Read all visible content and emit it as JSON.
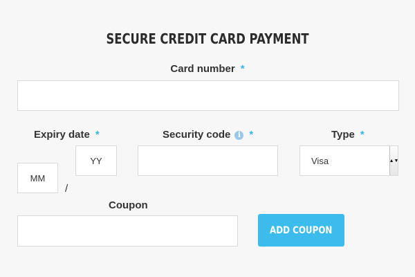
{
  "form": {
    "title": "SECURE CREDIT CARD PAYMENT",
    "required_mark": "*",
    "card_number": {
      "label": "Card number",
      "value": ""
    },
    "expiry": {
      "label": "Expiry date",
      "month_placeholder": "MM",
      "year_placeholder": "YY",
      "separator": "/"
    },
    "security_code": {
      "label": "Security code",
      "info_icon": "info-icon",
      "value": ""
    },
    "type": {
      "label": "Type",
      "selected": "Visa"
    },
    "coupon": {
      "label": "Coupon",
      "value": ""
    },
    "add_coupon_button": "ADD COUPON"
  },
  "colors": {
    "background": "#f7f7f7",
    "accent": "#3cbcec",
    "required": "#39b5e6",
    "field_border": "#d9d9d9"
  }
}
